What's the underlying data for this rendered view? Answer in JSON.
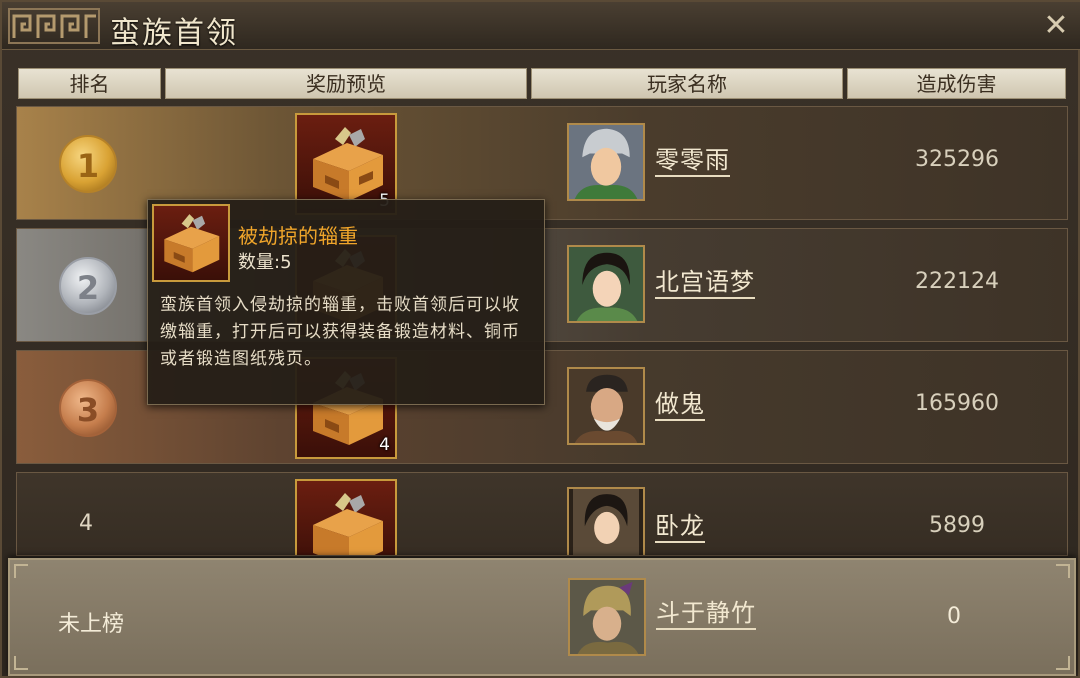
{
  "window": {
    "title": "蛮族首领",
    "close_icon": "close-icon"
  },
  "headers": {
    "rank": "排名",
    "reward": "奖励预览",
    "player": "玩家名称",
    "damage": "造成伤害"
  },
  "rows": [
    {
      "rank": "1",
      "medal": "gold",
      "reward_count": "5",
      "player": "零零雨",
      "damage": "325296"
    },
    {
      "rank": "2",
      "medal": "silver",
      "reward_count": "",
      "player": "北宫语梦",
      "damage": "222124"
    },
    {
      "rank": "3",
      "medal": "bronze",
      "reward_count": "4",
      "player": "做鬼",
      "damage": "165960"
    },
    {
      "rank": "4",
      "medal": "",
      "reward_count": "",
      "player": "卧龙",
      "damage": "5899"
    }
  ],
  "self": {
    "rank": "未上榜",
    "player": "斗于静竹",
    "damage": "0"
  },
  "tooltip": {
    "name": "被劫掠的辎重",
    "quantity": "数量:5",
    "description": "蛮族首领入侵劫掠的辎重，击败首领后可以收缴辎重，打开后可以获得装备锻造材料、铜币或者锻造图纸残页。"
  },
  "colors": {
    "tooltip_name": "#f0a52a",
    "gold": "#d9a233",
    "silver": "#b0b4ba",
    "bronze": "#c57d4c"
  }
}
